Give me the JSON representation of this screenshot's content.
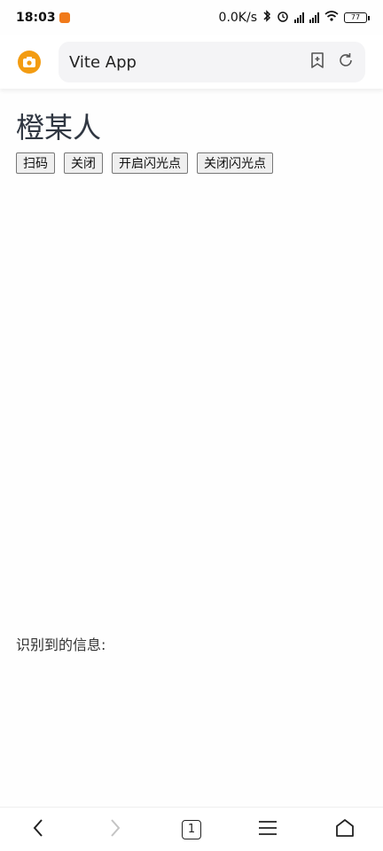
{
  "status_bar": {
    "time": "18:03",
    "speed": "0.0K/s",
    "battery": "77"
  },
  "browser": {
    "url_text": "Vite App",
    "tab_count": "1"
  },
  "page": {
    "title": "橙某人",
    "buttons": {
      "scan": "扫码",
      "close": "关闭",
      "flash_on": "开启闪光点",
      "flash_off": "关闭闪光点"
    },
    "result_label": "识别到的信息:"
  }
}
